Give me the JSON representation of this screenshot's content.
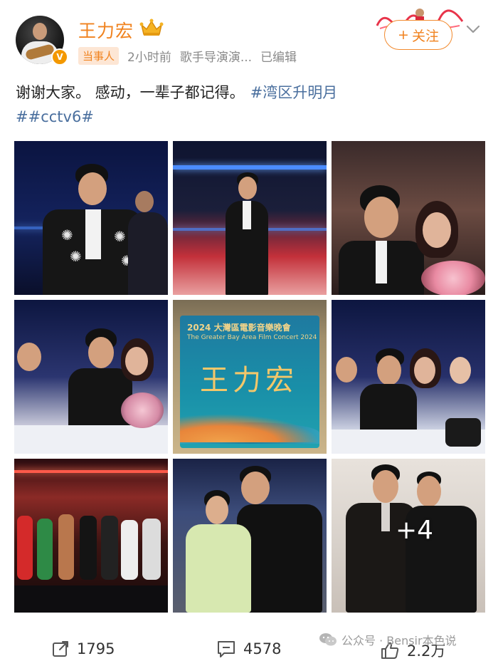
{
  "post": {
    "author": {
      "name": "王力宏",
      "badge_icon": "crown-icon",
      "verified_icon": "verified-v-icon",
      "verified_color": "#f39800"
    },
    "meta": {
      "tag": "当事人",
      "time": "2小时前",
      "profession": "歌手导演演...",
      "status": "已编辑"
    },
    "follow_button": {
      "plus": "+",
      "label": "关注"
    },
    "text": {
      "body": "谢谢大家。 感动，一辈子都记得。",
      "hashtag_1": "#湾区升明月",
      "hashtag_2": "##cctv6#"
    },
    "images": {
      "count_shown": 9,
      "more_overlay": "+4",
      "sign_title": "2024 大灣區電影音樂晚會",
      "sign_subtitle": "The Greater Bay Area Film Concert 2024",
      "sign_name": "王力宏"
    },
    "actions": {
      "repost": {
        "icon": "share-icon",
        "count": "1795"
      },
      "comment": {
        "icon": "comment-icon",
        "count": "4578"
      },
      "like": {
        "icon": "thumbs-up-icon",
        "count": "2.2万"
      }
    }
  },
  "watermark": {
    "icon": "wechat-icon",
    "text": "公众号 · Bensir本色说"
  },
  "colors": {
    "accent_orange": "#f0821e",
    "link_blue": "#4a6f9e",
    "meta_gray": "#8a8a8a"
  }
}
